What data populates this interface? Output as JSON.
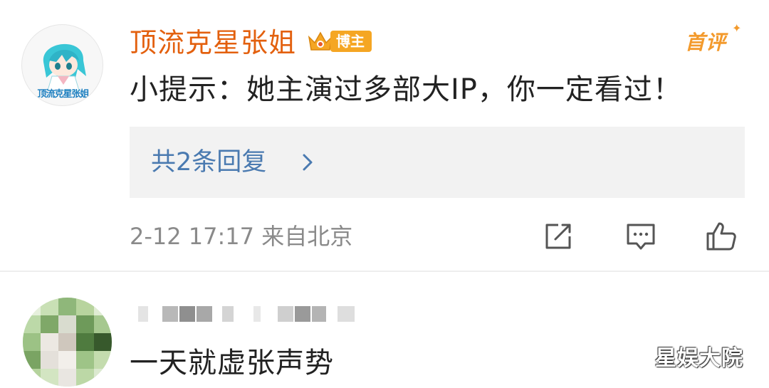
{
  "comments": [
    {
      "username": "顶流克星张姐",
      "avatar_caption": "顶流克星张姐",
      "badge_label": "博主",
      "first_tag": "首评",
      "content": "小提示：她主演过多部大IP，你一定看过！",
      "replies_label": "共2条回复",
      "meta": "2-12 17:17  来自北京",
      "actions": [
        "share-icon",
        "comment-icon",
        "like-icon"
      ]
    },
    {
      "content": "一天就虚张声势"
    }
  ],
  "watermark": "星娱大院",
  "colors": {
    "username": "#e3600e",
    "replies_link": "#4a7ab0",
    "badge": "#f5a623",
    "meta": "#8a8a8a"
  }
}
